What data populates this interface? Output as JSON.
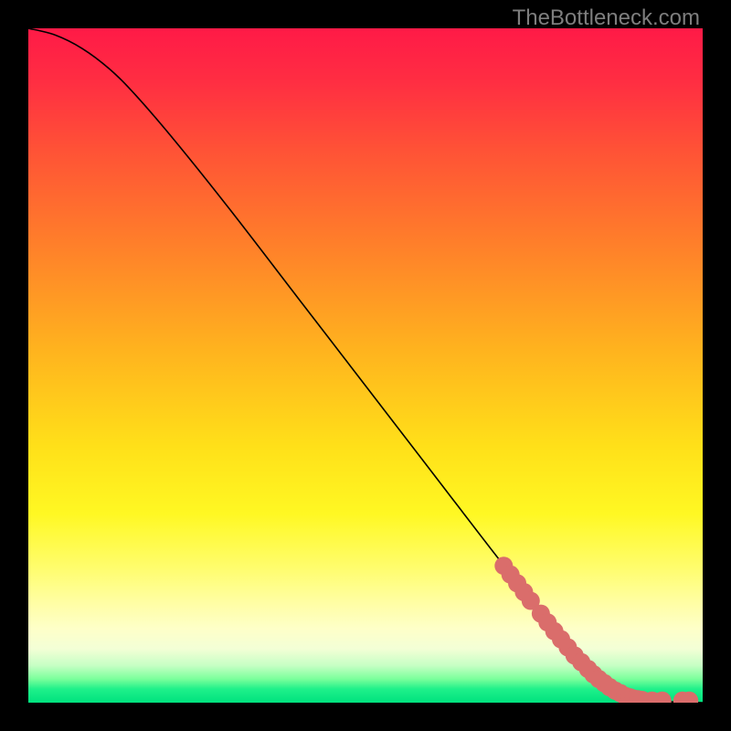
{
  "attribution": "TheBottleneck.com",
  "colors": {
    "curve": "#000000",
    "marker_fill": "#da6d6b",
    "marker_stroke": "#da6d6b",
    "gradient_top": "#ff1a47",
    "gradient_mid": "#ffe019",
    "gradient_bottom": "#00e27e",
    "frame": "#000000"
  },
  "chart_data": {
    "type": "line",
    "title": "",
    "xlabel": "",
    "ylabel": "",
    "xlim": [
      0,
      100
    ],
    "ylim": [
      0,
      100
    ],
    "grid": false,
    "series": [
      {
        "name": "curve",
        "x": [
          0,
          4,
          8,
          12,
          16,
          22,
          30,
          40,
          50,
          60,
          70,
          78,
          82,
          85,
          88,
          90,
          92,
          94,
          96,
          98,
          100
        ],
        "y": [
          100,
          99,
          97,
          94,
          90,
          83,
          73,
          60,
          47,
          34,
          21,
          11,
          6,
          3,
          1.5,
          0.8,
          0.4,
          0.2,
          0.1,
          0.05,
          0
        ]
      }
    ],
    "markers": {
      "name": "data-points",
      "shape": "circle",
      "radius_px": 10,
      "x": [
        70.5,
        71.5,
        72.5,
        73.5,
        74.5,
        76.0,
        77.0,
        78.0,
        79.0,
        80.0,
        81.0,
        82.0,
        83.0,
        83.8,
        84.6,
        85.4,
        86.2,
        87.0,
        87.8,
        88.5,
        89.2,
        89.8,
        90.4,
        91.0,
        92.5,
        94.0,
        97.0,
        98.0
      ],
      "y": [
        20.3,
        19.0,
        17.7,
        16.4,
        15.1,
        13.2,
        11.9,
        10.6,
        9.4,
        8.2,
        7.0,
        6.0,
        5.0,
        4.2,
        3.5,
        2.9,
        2.3,
        1.8,
        1.4,
        1.0,
        0.8,
        0.6,
        0.5,
        0.4,
        0.3,
        0.3,
        0.3,
        0.3
      ]
    }
  }
}
